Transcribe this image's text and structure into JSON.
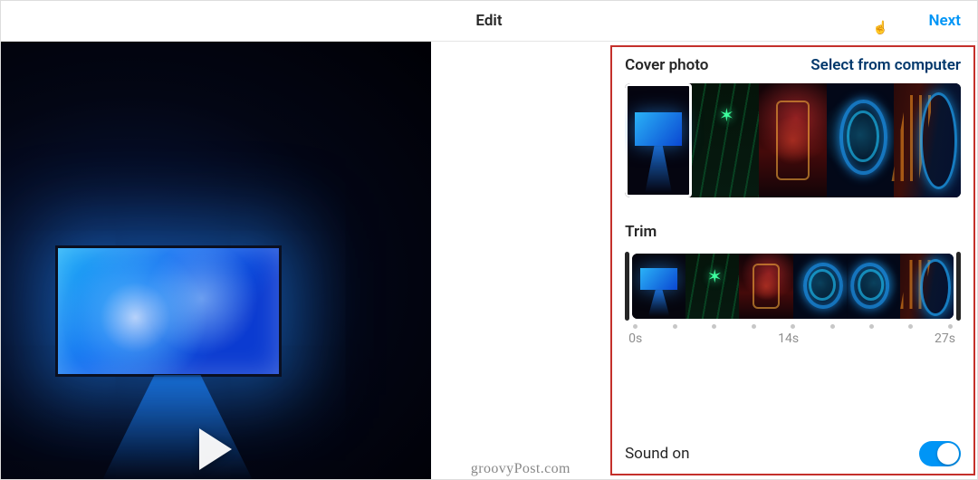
{
  "header": {
    "title": "Edit",
    "next": "Next"
  },
  "sidebar": {
    "cover_label": "Cover photo",
    "select_link": "Select from computer",
    "trim_label": "Trim",
    "time": {
      "start": "0s",
      "mid": "14s",
      "end": "27s"
    },
    "sound_label": "Sound on",
    "sound_on": true
  },
  "watermark": "groovyPost.com"
}
